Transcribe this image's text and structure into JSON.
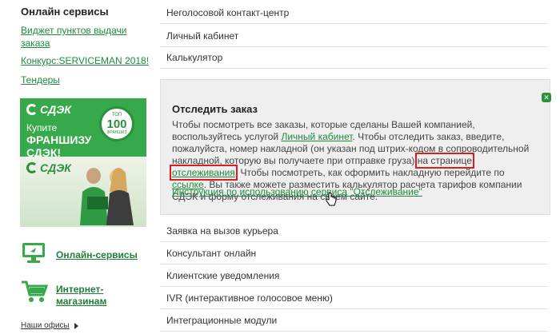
{
  "sidebar": {
    "title": "Онлайн сервисы",
    "links": [
      "Виджет пунктов выдачи",
      "заказа",
      "Конкурс:SERVICEMAN 2018!",
      "Тендеры"
    ],
    "banner1": {
      "logo": "СДЭК",
      "line1": "Купите",
      "line2": "ФРАНШИЗУ",
      "line3": "СДЭК!",
      "seal_top": "ТОП",
      "seal_num": "100",
      "seal_bottom": "ФРАНШИЗ"
    },
    "banner2": {
      "logo": "СДЭК"
    },
    "services": [
      {
        "label": "Онлайн-сервисы",
        "icon": "monitor-icon"
      },
      {
        "label": "Интернет-",
        "label2": "магазинам",
        "icon": "cart-icon"
      }
    ],
    "offices": "Наши офисы"
  },
  "main": {
    "top_rows": [
      "Неголосовой контакт-центр",
      "Личный кабинет",
      "Калькулятор"
    ],
    "panel": {
      "title": "Отследить заказ",
      "text_1": "Чтобы посмотреть все заказы, которые сделаны Вашей компанией, воспользуйтесь услугой ",
      "link_cabinet": "Личный кабинет",
      "text_2": ". Чтобы отследить заказ, введите, пожалуйста, номер накладной (он указан под штрих-кодом в сопроводительной накладной, которую вы получаете при отправке груза) ",
      "text_hl": "на странице ",
      "link_tracking": "отслеживания",
      "text_3": ". Чтобы посмотреть, как оформить накладную перейдите по ",
      "link_here": "ссылке",
      "text_4": ". Вы также можете разместить калькулятор расчета тарифов компании СДЭК и форму отслеживания на своем сайте.",
      "instruction": "Инструкция по использованию сервиса \"Отслеживание\"",
      "close_icon": "close-icon"
    },
    "bottom_rows": [
      "Заявка на вызов курьера",
      "Консультант онлайн",
      "Клиентские уведомления",
      "IVR (интерактивное голосовое меню)",
      "Интеграционные модули"
    ]
  },
  "colors": {
    "brand_green": "#36a94a",
    "link_green": "#1f8a3c",
    "highlight_red": "#e01b22"
  }
}
